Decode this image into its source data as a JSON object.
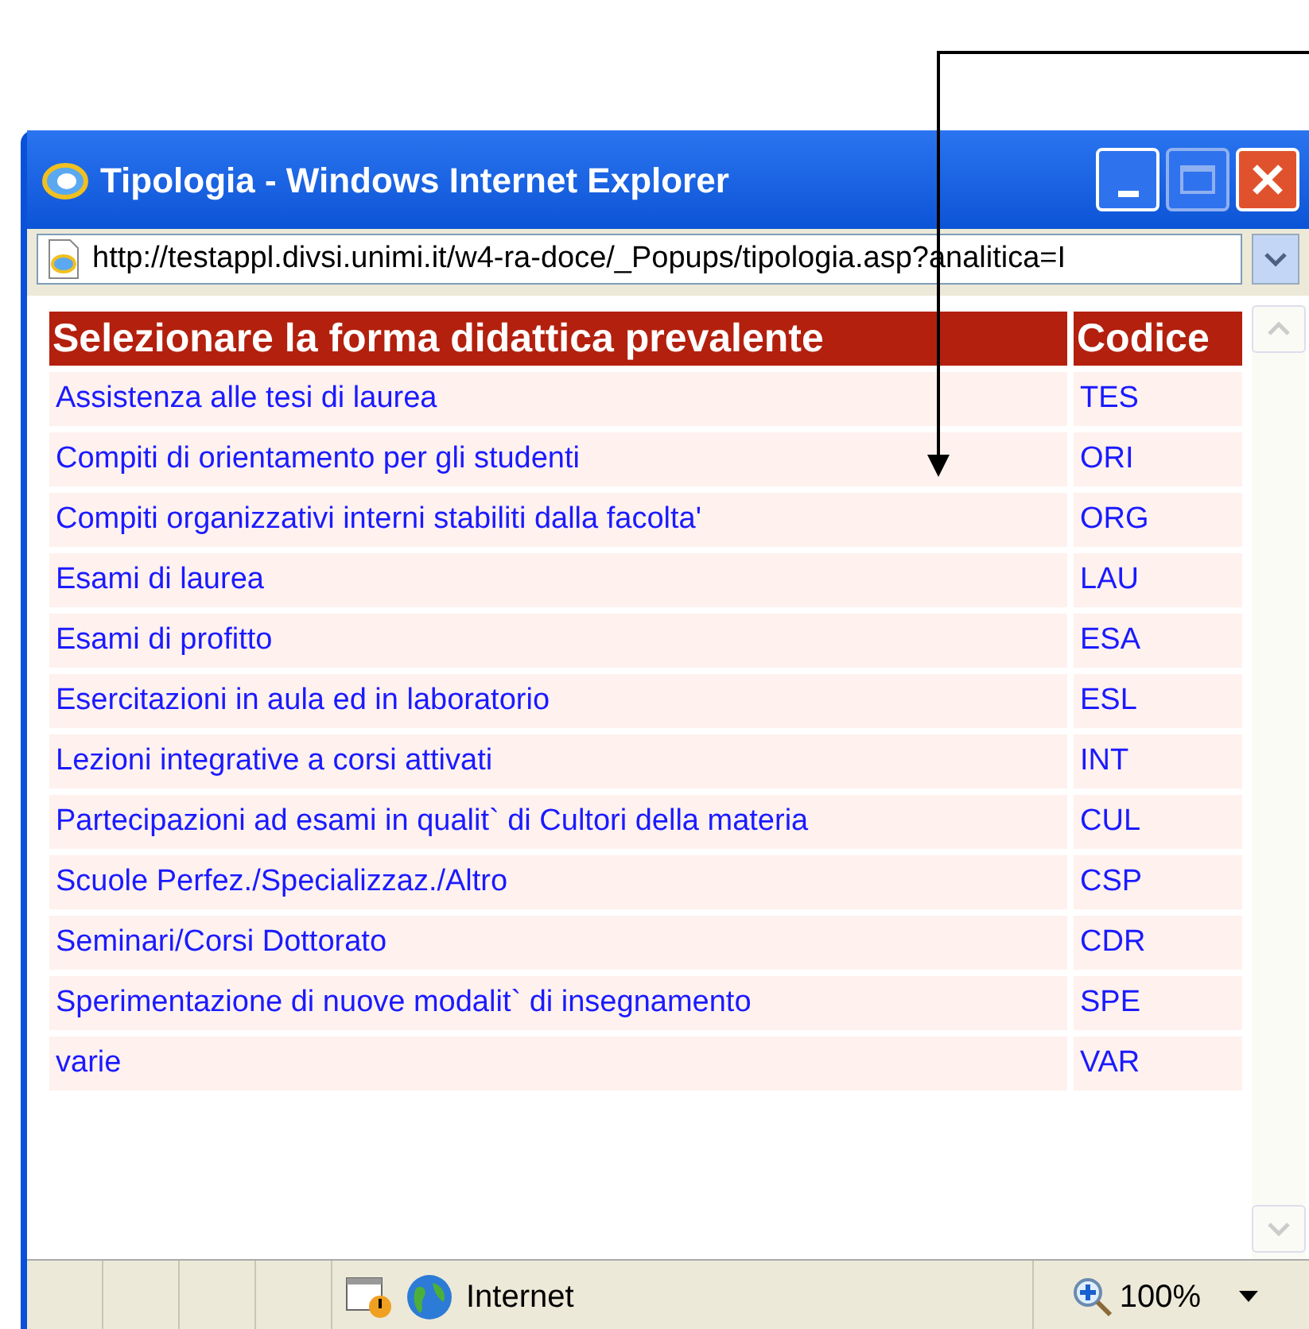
{
  "window": {
    "title": "Tipologia - Windows Internet Explorer"
  },
  "address_bar": {
    "url": "http://testappl.divsi.unimi.it/w4-ra-doce/_Popups/tipologia.asp?analitica=I"
  },
  "table": {
    "columns": [
      "Selezionare la forma didattica prevalente",
      "Codice"
    ],
    "rows": [
      {
        "forma": "Assistenza alle tesi di laurea",
        "codice": "TES"
      },
      {
        "forma": "Compiti di orientamento per gli studenti",
        "codice": "ORI"
      },
      {
        "forma": "Compiti organizzativi interni stabiliti dalla facolta'",
        "codice": "ORG"
      },
      {
        "forma": "Esami di laurea",
        "codice": "LAU"
      },
      {
        "forma": "Esami di profitto",
        "codice": "ESA"
      },
      {
        "forma": "Esercitazioni in aula ed in laboratorio",
        "codice": "ESL"
      },
      {
        "forma": "Lezioni integrative a corsi attivati",
        "codice": "INT"
      },
      {
        "forma": "Partecipazioni ad esami in qualit` di Cultori della materia",
        "codice": "CUL"
      },
      {
        "forma": "Scuole Perfez./Specializzaz./Altro",
        "codice": "CSP"
      },
      {
        "forma": "Seminari/Corsi Dottorato",
        "codice": "CDR"
      },
      {
        "forma": "Sperimentazione di nuove modalit` di insegnamento",
        "codice": "SPE"
      },
      {
        "forma": "varie",
        "codice": "VAR"
      }
    ]
  },
  "status_bar": {
    "zone": "Internet",
    "zoom": "100%"
  }
}
